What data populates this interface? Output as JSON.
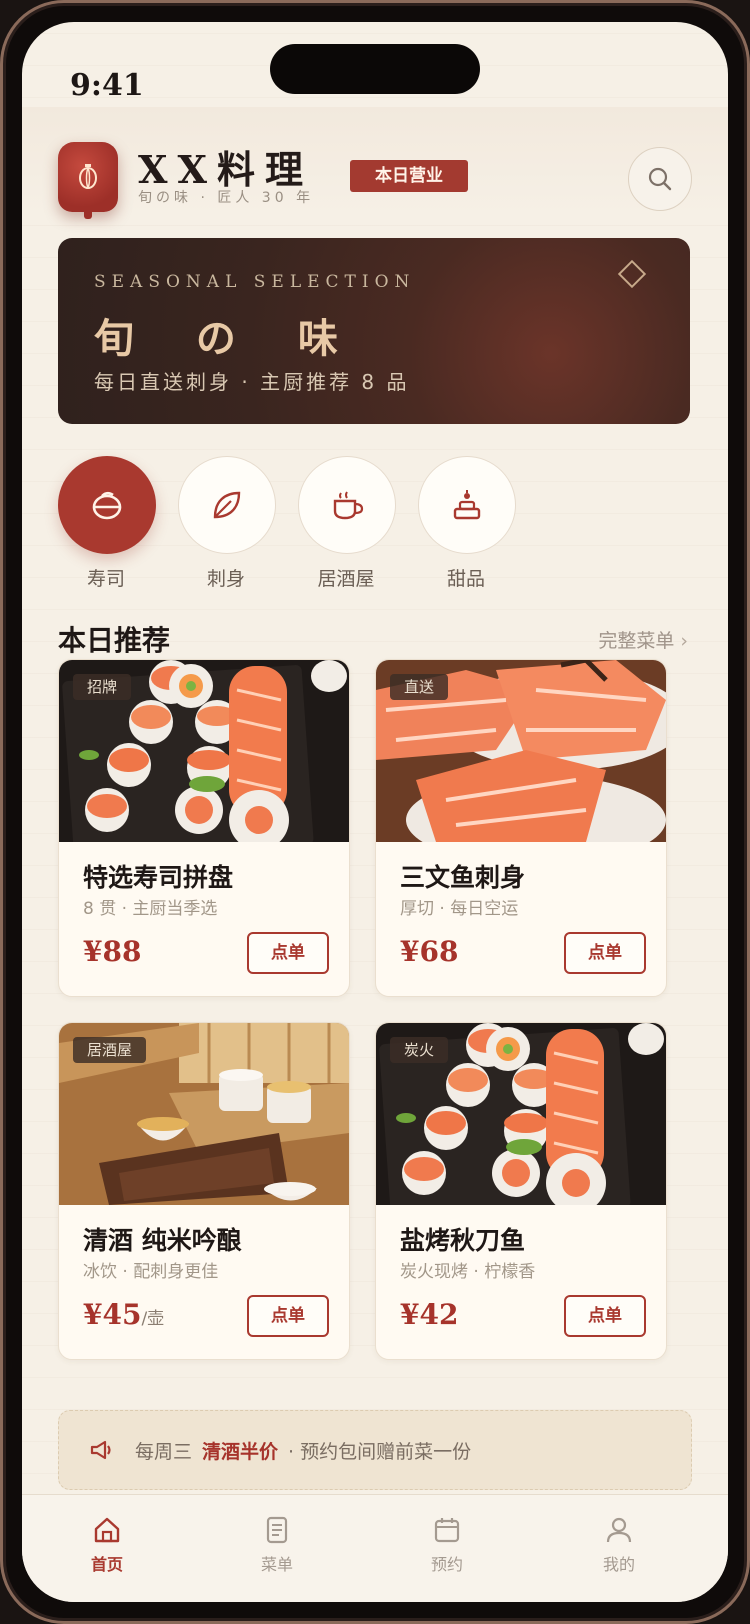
{
  "status_bar": {
    "time": "9:41"
  },
  "header": {
    "brand_name": "XX料理",
    "brand_sub": "旬の味 · 匠人 30 年",
    "open_badge": "本日营业",
    "logo_icon": "lantern-icon",
    "search_icon": "search-icon"
  },
  "banner": {
    "eyebrow": "SEASONAL SELECTION",
    "title": "旬 の 味",
    "description": "每日直送刺身 · 主厨推荐 8 品"
  },
  "categories": [
    {
      "label": "寿司",
      "icon": "sushi-icon",
      "active": true
    },
    {
      "label": "刺身",
      "icon": "leaf-icon",
      "active": false
    },
    {
      "label": "居酒屋",
      "icon": "cup-icon",
      "active": false
    },
    {
      "label": "甜品",
      "icon": "dessert-icon",
      "active": false
    }
  ],
  "section": {
    "title": "本日推荐",
    "link": "完整菜单",
    "link_chevron": "›"
  },
  "menu_items": [
    {
      "tag": "招牌",
      "name": "特选寿司拼盘",
      "desc": "8 贯 · 主厨当季选",
      "price": "¥88",
      "unit": "",
      "button": "点单"
    },
    {
      "tag": "直送",
      "name": "三文鱼刺身",
      "desc": "厚切 · 每日空运",
      "price": "¥68",
      "unit": "",
      "button": "点单"
    },
    {
      "tag": "居酒屋",
      "name": "清酒 纯米吟酿",
      "desc": "冰饮 · 配刺身更佳",
      "price": "¥45",
      "unit": "/壶",
      "button": "点单"
    },
    {
      "tag": "炭火",
      "name": "盐烤秋刀鱼",
      "desc": "炭火现烤 · 柠檬香",
      "price": "¥42",
      "unit": "",
      "button": "点单"
    }
  ],
  "notice": {
    "prefix": "每周三",
    "highlight": "清酒半价",
    "suffix": "· 预约包间赠前菜一份",
    "icon": "megaphone-icon"
  },
  "tabbar": [
    {
      "label": "首页",
      "icon": "home-icon",
      "active": true
    },
    {
      "label": "菜单",
      "icon": "menu-icon",
      "active": false
    },
    {
      "label": "预约",
      "icon": "calendar-icon",
      "active": false
    },
    {
      "label": "我的",
      "icon": "user-icon",
      "active": false
    }
  ],
  "colors": {
    "accent": "#a9392f",
    "background": "#f6f0e6",
    "banner": "#3a251f"
  }
}
